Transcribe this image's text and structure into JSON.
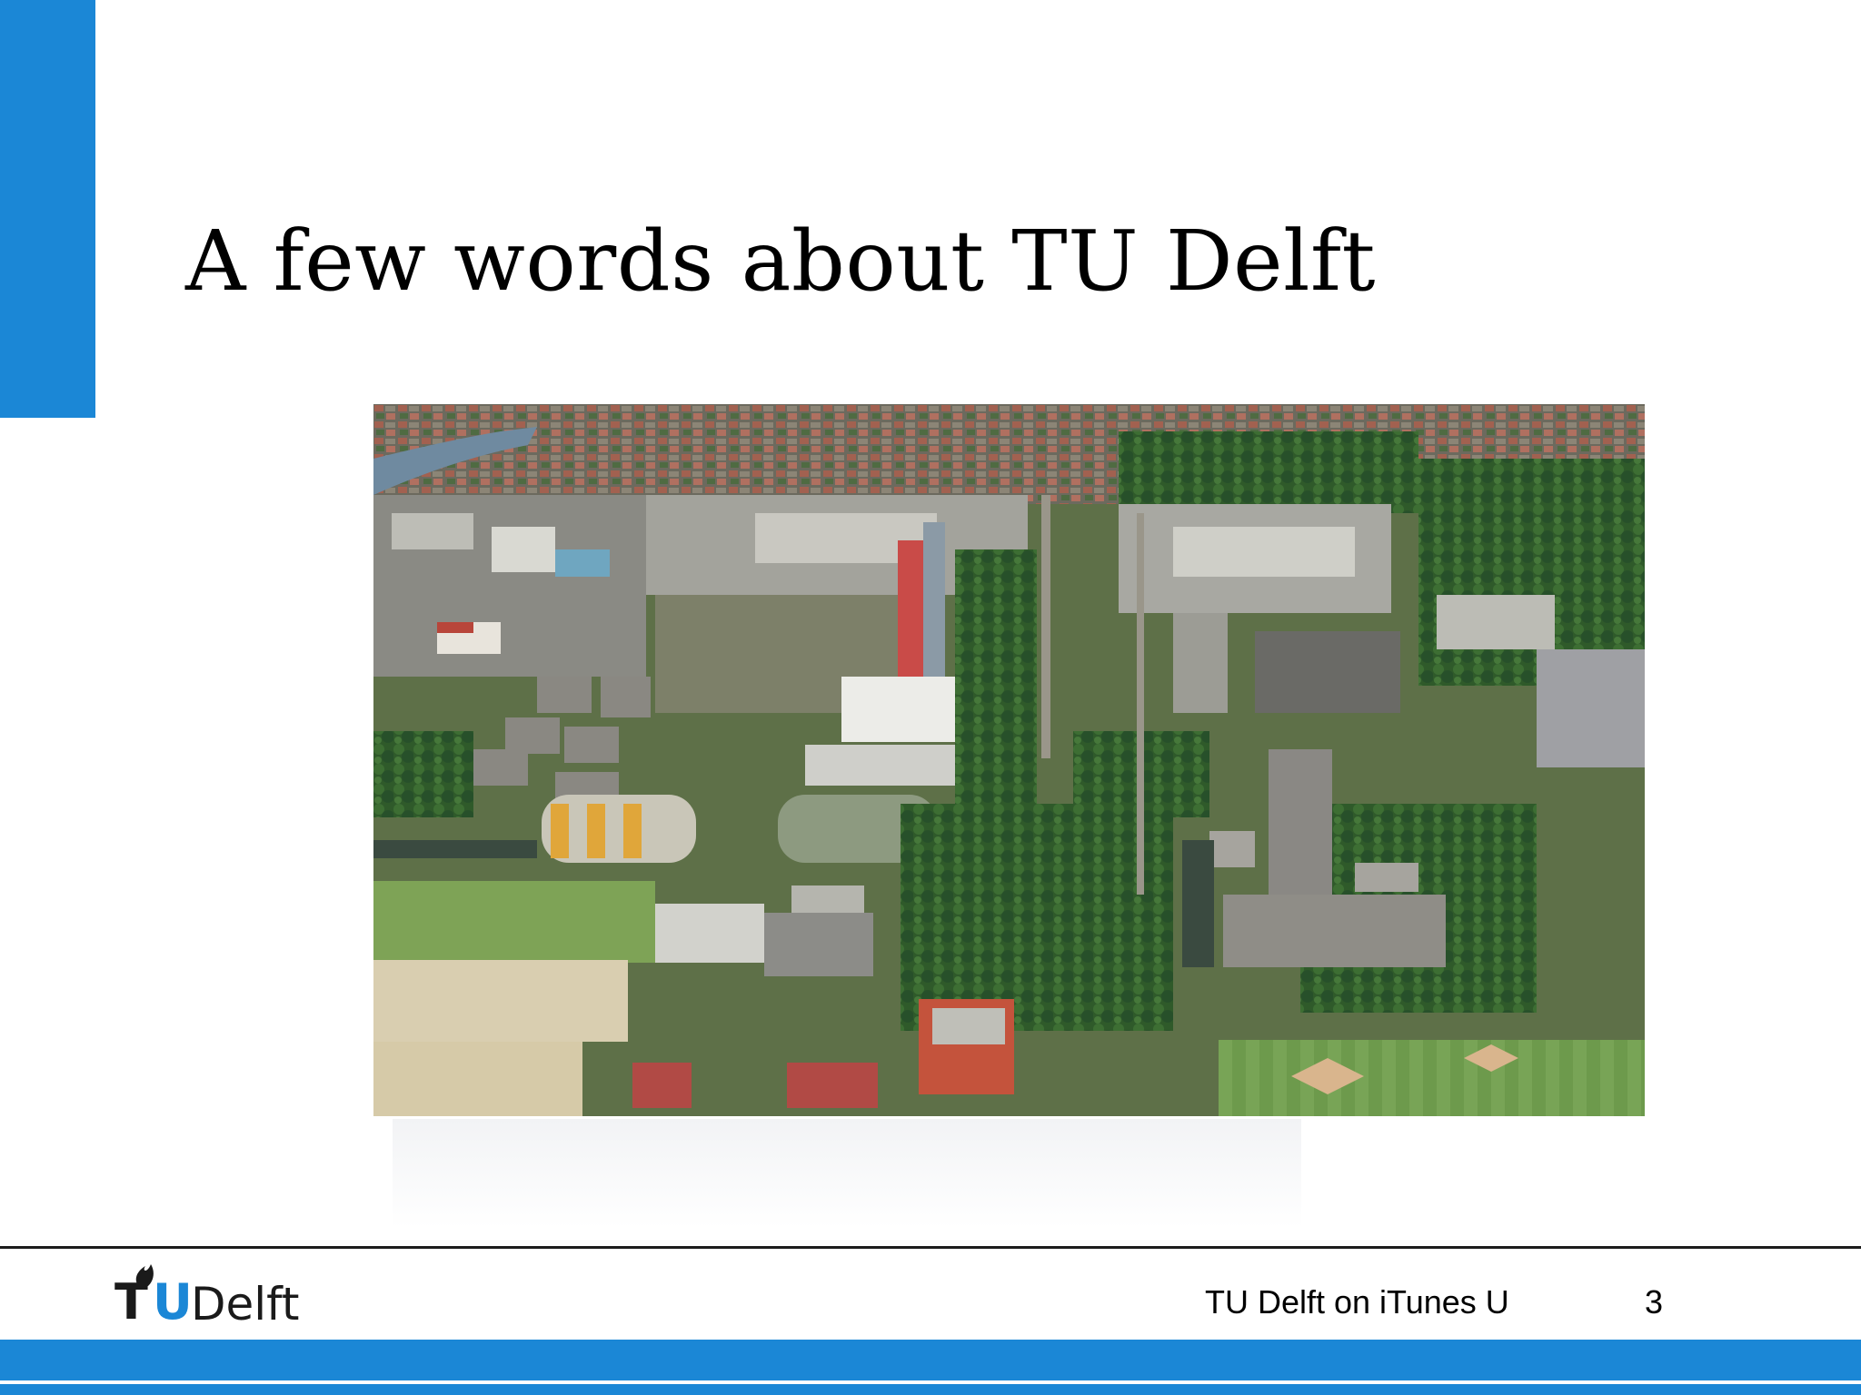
{
  "slide": {
    "title": "A few words about TU Delft"
  },
  "photo": {
    "subject": "aerial-campus-photo"
  },
  "footer": {
    "logo": {
      "letter_t": "T",
      "letter_u": "U",
      "word": "Delft"
    },
    "label": "TU Delft on iTunes U",
    "page_number": "3"
  },
  "colors": {
    "accent": "#1b87d6",
    "text": "#000000",
    "background": "#ffffff"
  }
}
